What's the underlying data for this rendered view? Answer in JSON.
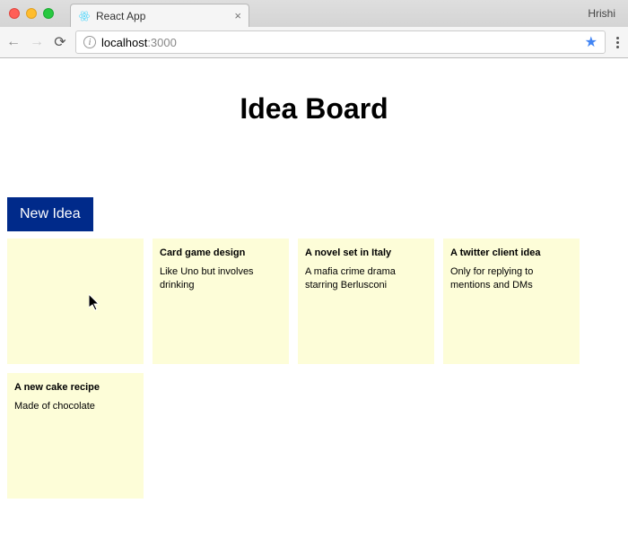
{
  "browser": {
    "profile_name": "Hrishi",
    "tab": {
      "title": "React App",
      "close_label": "×"
    },
    "url_host": "localhost",
    "url_rest": ":3000",
    "info_icon_label": "i",
    "star_label": "★"
  },
  "page": {
    "title": "Idea Board",
    "new_idea_label": "New Idea"
  },
  "ideas": [
    {
      "title": "",
      "body": ""
    },
    {
      "title": "Card game design",
      "body": "Like Uno but involves drinking"
    },
    {
      "title": "A novel set in Italy",
      "body": "A mafia crime drama starring Berlusconi"
    },
    {
      "title": "A twitter client idea",
      "body": "Only for replying to mentions and DMs"
    },
    {
      "title": "A new cake recipe",
      "body": "Made of chocolate"
    }
  ]
}
